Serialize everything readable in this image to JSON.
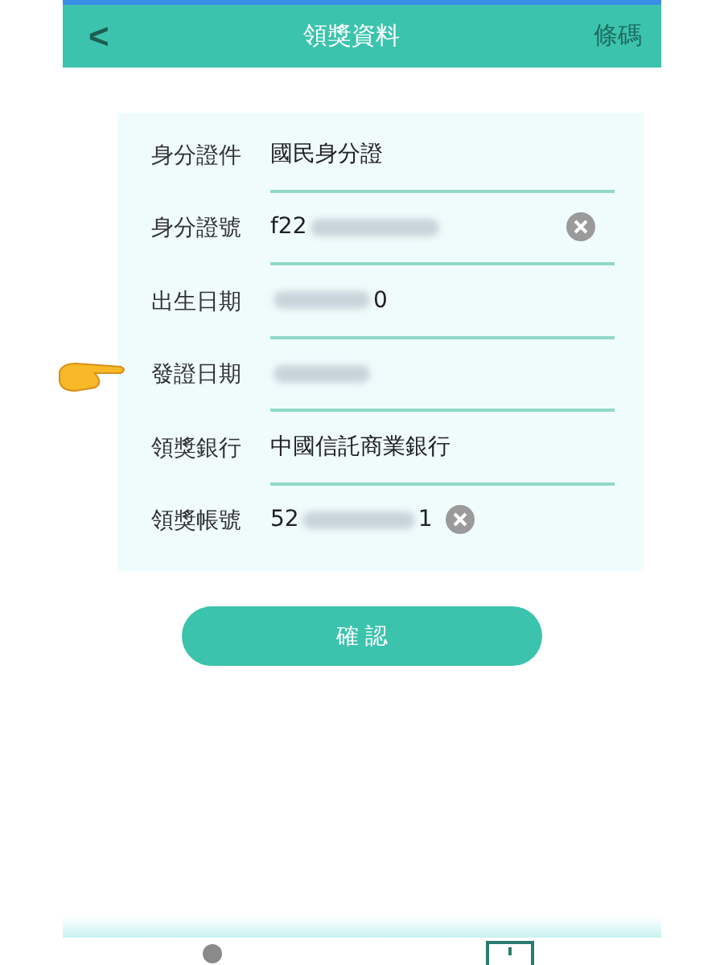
{
  "header": {
    "back": "<",
    "title": "領獎資料",
    "action": "條碼"
  },
  "fields": [
    {
      "label": "身分證件",
      "prefix": "國民身分證",
      "blurred": false,
      "clearable": false,
      "pointed": false
    },
    {
      "label": "身分證號",
      "prefix": "f22",
      "blurred": true,
      "clearable": true,
      "pointed": false
    },
    {
      "label": "出生日期",
      "suffix": "0",
      "blurred": true,
      "clearable": false,
      "pointed": false
    },
    {
      "label": "發證日期",
      "blurred": true,
      "clearable": false,
      "pointed": true
    },
    {
      "label": "領獎銀行",
      "prefix": "中國信託商業銀行",
      "blurred": false,
      "clearable": false,
      "pointed": false
    },
    {
      "label": "領獎帳號",
      "prefix": "52",
      "suffix": "1",
      "blurred": true,
      "clearable": true,
      "pointed": false
    }
  ],
  "confirm": "確 認"
}
